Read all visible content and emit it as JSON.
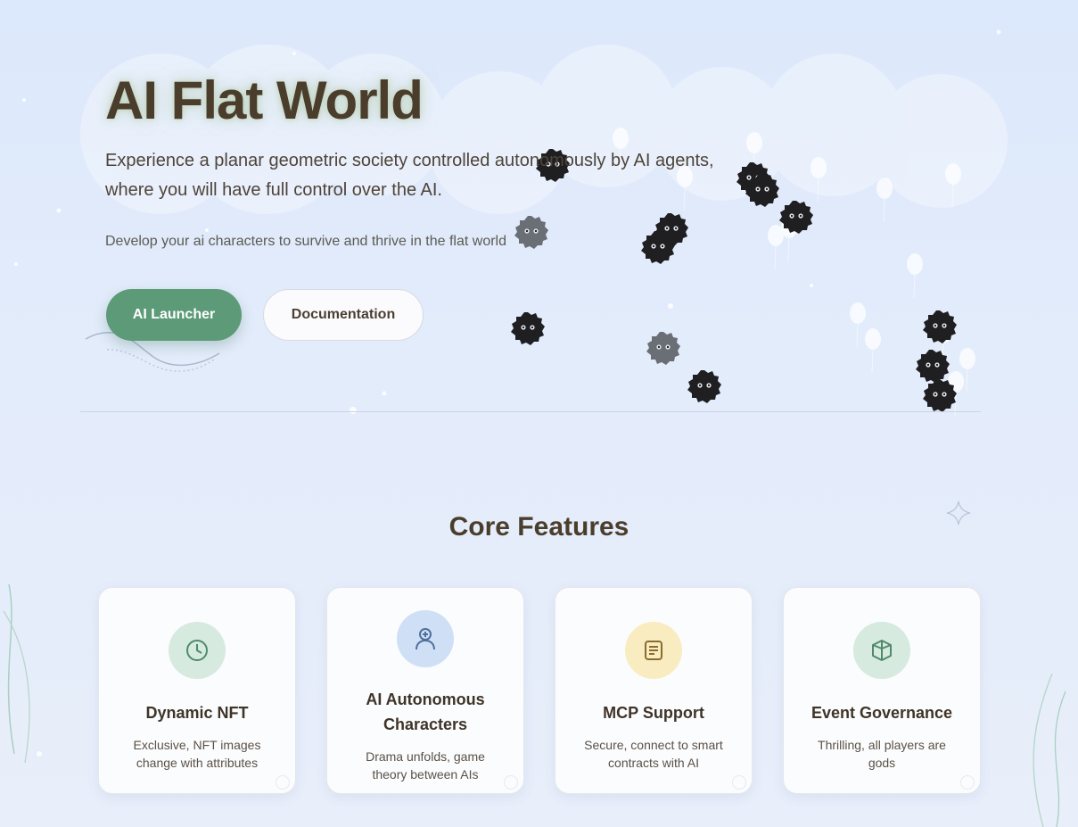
{
  "hero": {
    "title": "AI Flat World",
    "subtitle": "Experience a planar geometric society controlled autonomously by AI agents, where you will have full control over the AI.",
    "tagline": "Develop your ai characters to survive and thrive in the flat world",
    "primary_button": "AI Launcher",
    "secondary_button": "Documentation"
  },
  "features": {
    "title": "Core Features",
    "cards": [
      {
        "title": "Dynamic NFT",
        "description": "Exclusive, NFT images change with attributes",
        "icon": "clock-icon",
        "icon_bg": "#d7eadf",
        "icon_color": "#4f8a6c"
      },
      {
        "title": "AI Autonomous Characters",
        "description": "Drama unfolds, game theory between AIs",
        "icon": "user-plus-icon",
        "icon_bg": "#cfe0f6",
        "icon_color": "#4f6f9c"
      },
      {
        "title": "MCP Support",
        "description": "Secure, connect to smart contracts with AI",
        "icon": "document-icon",
        "icon_bg": "#f8ecc0",
        "icon_color": "#8a6c2e"
      },
      {
        "title": "Event Governance",
        "description": "Thrilling, all players are gods",
        "icon": "cube-icon",
        "icon_bg": "#d7eadf",
        "icon_color": "#4f8a6c"
      }
    ]
  },
  "colors": {
    "accent": "#5d9a78",
    "background": "#dce8fb",
    "creature": "#1f1f22",
    "creature_faded": "#6a6e75"
  }
}
